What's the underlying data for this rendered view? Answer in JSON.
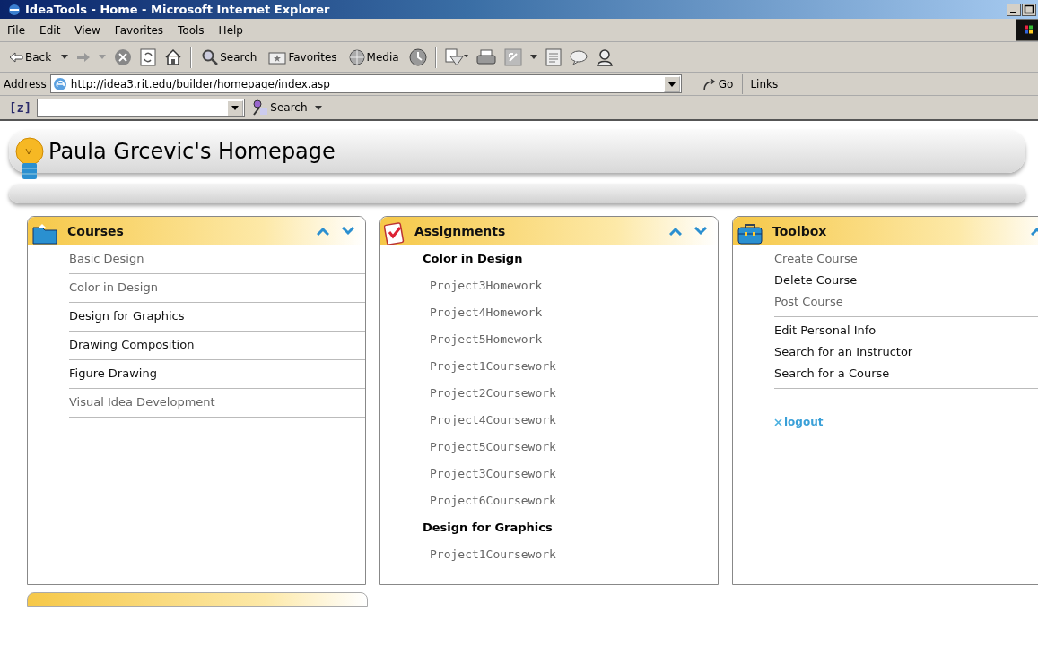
{
  "window": {
    "title": "IdeaTools - Home - Microsoft Internet Explorer"
  },
  "menu": [
    "File",
    "Edit",
    "View",
    "Favorites",
    "Tools",
    "Help"
  ],
  "toolbar": {
    "back": "Back",
    "search": "Search",
    "favorites": "Favorites",
    "media": "Media"
  },
  "address_bar": {
    "label": "Address",
    "value": "http://idea3.rit.edu/builder/homepage/index.asp",
    "go": "Go",
    "links": "Links"
  },
  "search_toolbar": {
    "logo": "[z]",
    "search": "Search"
  },
  "page": {
    "title": "Paula Grcevic's Homepage",
    "courses": {
      "title": "Courses",
      "items": [
        {
          "label": "Basic Design",
          "greyed": true
        },
        {
          "label": "Color in Design",
          "greyed": true
        },
        {
          "label": "Design for Graphics",
          "greyed": false
        },
        {
          "label": "Drawing Composition",
          "greyed": false
        },
        {
          "label": "Figure Drawing",
          "greyed": false
        },
        {
          "label": "Visual Idea Development",
          "greyed": true
        }
      ]
    },
    "assignments": {
      "title": "Assignments",
      "groups": [
        {
          "heading": "Color in Design",
          "items": [
            "Project3Homework",
            "Project4Homework",
            "Project5Homework",
            "Project1Coursework",
            "Project2Coursework",
            "Project4Coursework",
            "Project5Coursework",
            "Project3Coursework",
            "Project6Coursework"
          ]
        },
        {
          "heading": "Design for Graphics",
          "items": [
            "Project1Coursework"
          ]
        }
      ]
    },
    "toolbox": {
      "title": "Toolbox",
      "groups": [
        [
          {
            "label": "Create Course",
            "greyed": true
          },
          {
            "label": "Delete Course",
            "greyed": false
          },
          {
            "label": "Post Course",
            "greyed": true
          }
        ],
        [
          {
            "label": "Edit Personal Info",
            "greyed": false
          },
          {
            "label": "Search for an Instructor",
            "greyed": false
          },
          {
            "label": "Search for a Course",
            "greyed": false
          }
        ]
      ],
      "logout": "logout"
    }
  }
}
